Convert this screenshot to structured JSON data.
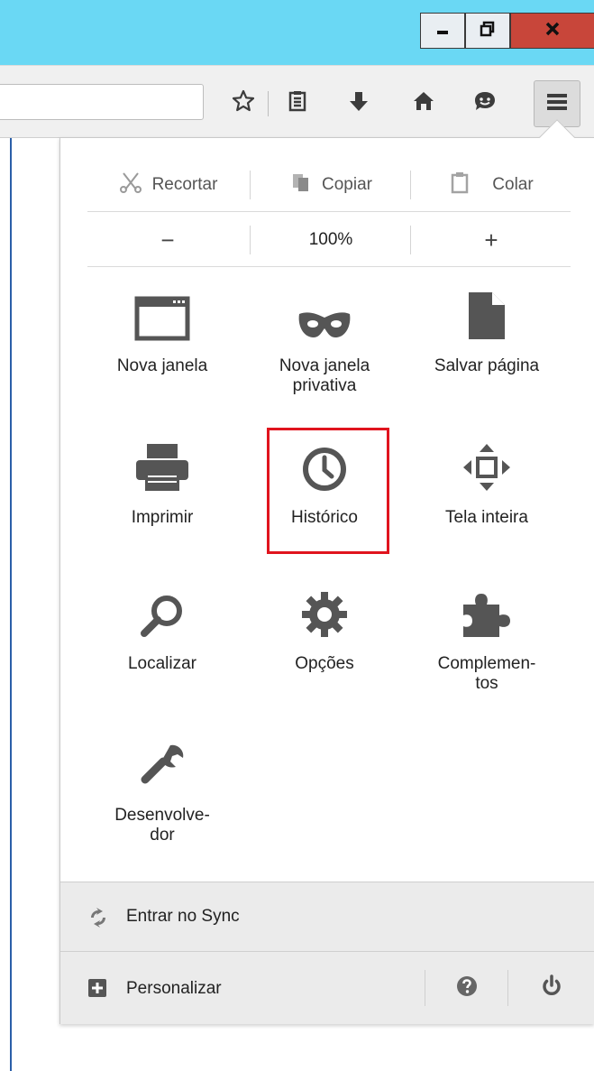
{
  "window_controls": {
    "minimize_icon": "minimize-icon",
    "restore_icon": "restore-icon",
    "close_icon": "close-icon"
  },
  "toolbar": {
    "icons": [
      "star-bookmark-icon",
      "bookmarks-list-icon",
      "downloads-arrow-icon",
      "home-icon",
      "chat-bubble-icon",
      "hamburger-menu-icon"
    ]
  },
  "menu": {
    "edit": {
      "cut": "Recortar",
      "copy": "Copiar",
      "paste": "Colar"
    },
    "zoom": {
      "minus": "−",
      "value": "100%",
      "plus": "+"
    },
    "items": [
      {
        "label": "Nova janela",
        "icon": "window-icon"
      },
      {
        "label": "Nova janela\nprivativa",
        "icon": "private-mask-icon"
      },
      {
        "label": "Salvar página",
        "icon": "page-icon"
      },
      {
        "label": "Imprimir",
        "icon": "printer-icon"
      },
      {
        "label": "Histórico",
        "icon": "clock-icon"
      },
      {
        "label": "Tela inteira",
        "icon": "fullscreen-icon"
      },
      {
        "label": "Localizar",
        "icon": "magnifier-icon"
      },
      {
        "label": "Opções",
        "icon": "gear-icon"
      },
      {
        "label": "Complemen-\ntos",
        "icon": "puzzle-icon"
      },
      {
        "label": "Desenvolve-\ndor",
        "icon": "wrench-icon"
      }
    ],
    "sync_label": "Entrar no Sync",
    "customize_label": "Personalizar"
  },
  "colors": {
    "titlebar": "#6ad8f4",
    "close_button": "#c8463a",
    "highlight": "#e0141e",
    "icon_gray": "#555555"
  }
}
